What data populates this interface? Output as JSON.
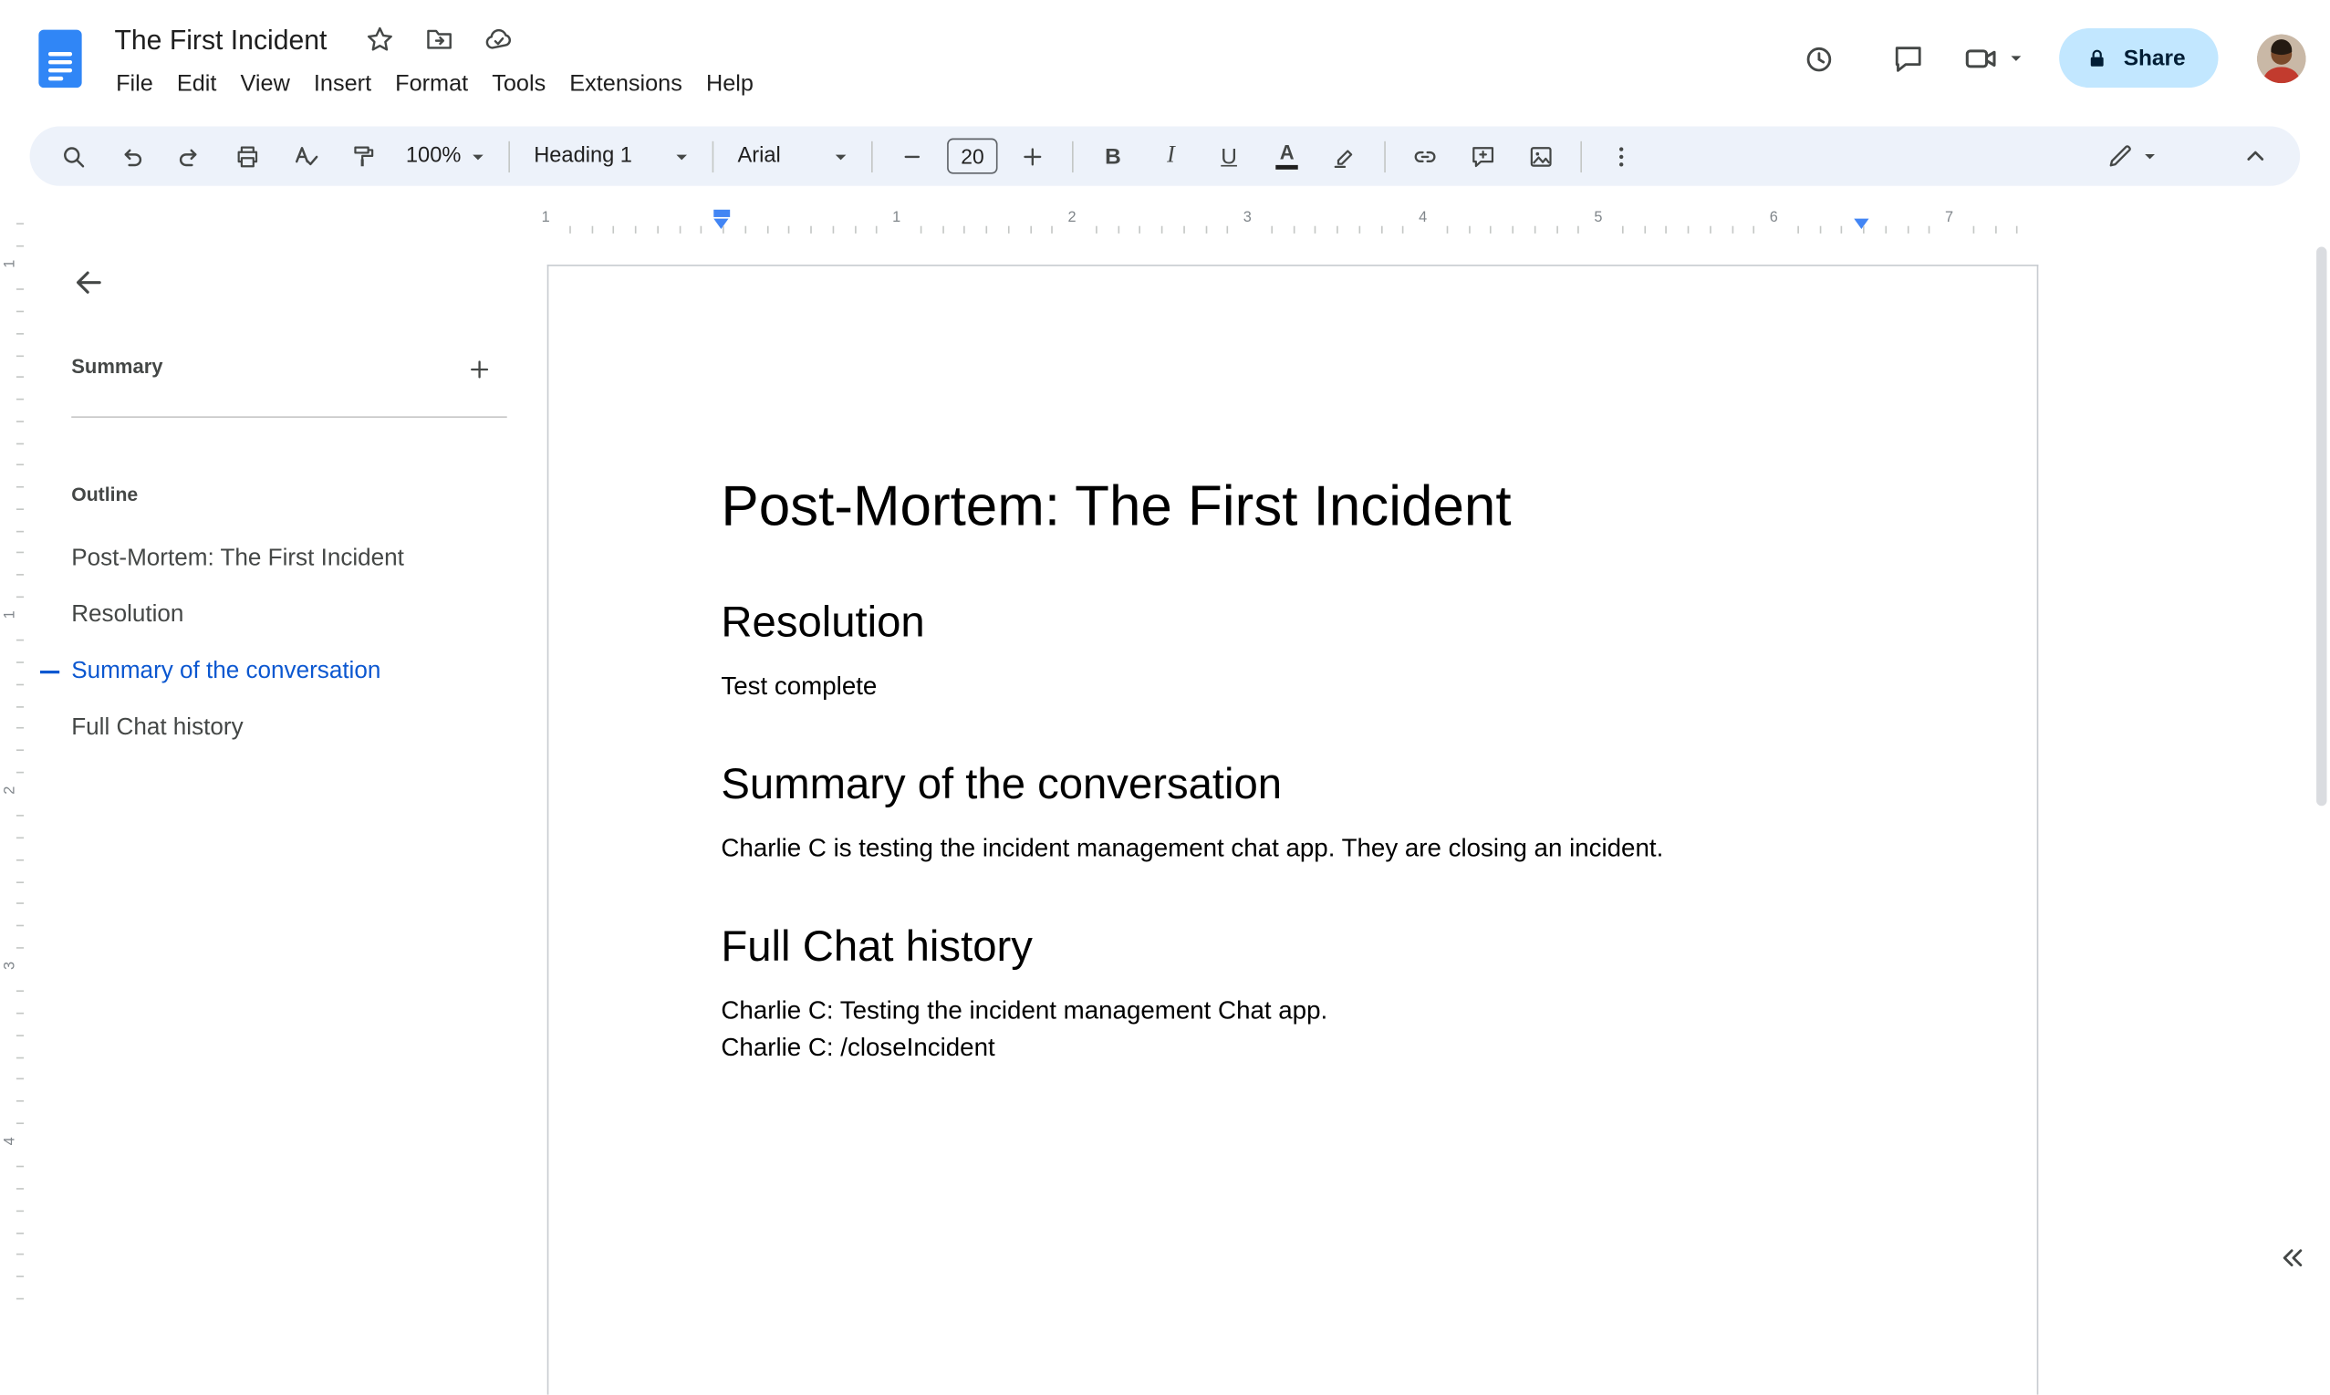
{
  "header": {
    "doc_title": "The First Incident",
    "menus": [
      "File",
      "Edit",
      "View",
      "Insert",
      "Format",
      "Tools",
      "Extensions",
      "Help"
    ],
    "share": "Share"
  },
  "toolbar": {
    "zoom": "100%",
    "paragraph_style": "Heading 1",
    "font": "Arial",
    "font_size": "20",
    "bold": "B",
    "italic": "I",
    "underline": "U",
    "text_color": "A"
  },
  "ruler": {
    "horizontal_labels": [
      "1",
      "1",
      "2",
      "3",
      "4",
      "5",
      "6",
      "7"
    ],
    "vertical_labels": [
      "1",
      "1",
      "2",
      "3",
      "4"
    ]
  },
  "sidebar": {
    "summary": "Summary",
    "outline": "Outline",
    "items": [
      {
        "label": "Post-Mortem: The First Incident",
        "active": false
      },
      {
        "label": "Resolution",
        "active": false
      },
      {
        "label": "Summary of the conversation",
        "active": true
      },
      {
        "label": "Full Chat history",
        "active": false
      }
    ]
  },
  "document": {
    "title": "Post-Mortem: The First Incident",
    "sections": [
      {
        "heading": "Resolution",
        "paragraphs": [
          "Test complete"
        ]
      },
      {
        "heading": "Summary of the conversation",
        "paragraphs": [
          "Charlie C is testing the incident management chat app. They are closing an incident."
        ]
      },
      {
        "heading": "Full Chat history",
        "paragraphs": [
          "Charlie C: Testing the incident management Chat app.",
          "Charlie C: /closeIncident"
        ]
      }
    ]
  },
  "icons": {
    "docs-logo": "blue-document",
    "star": "star-outline",
    "move": "folder-with-arrow",
    "cloud-saved": "cloud-with-check",
    "version-history": "clock",
    "comments": "speech-bubble",
    "video-call": "camera",
    "dropdown-caret": "▾",
    "lock": "padlock",
    "search": "magnifier",
    "undo": "↶",
    "redo": "↷",
    "print": "printer",
    "spellcheck": "A-check",
    "paint-format": "paint-roller",
    "highlight": "marker-pen",
    "insert-link": "chain",
    "add-comment": "bubble-plus",
    "insert-image": "picture",
    "more": "⋮",
    "editing-mode": "pencil",
    "collapse-toolbar": "chevron-up",
    "back": "←",
    "add-summary": "+",
    "font-size-decrease": "−",
    "font-size-increase": "+",
    "collapse-panel": "«"
  },
  "colors": {
    "toolbar_bg": "#edf2fa",
    "share_bg": "#c2e7ff",
    "share_text": "#001d35",
    "accent_blue": "#4285f4",
    "outline_active": "#0b57d0",
    "icon_gray": "#444746"
  }
}
